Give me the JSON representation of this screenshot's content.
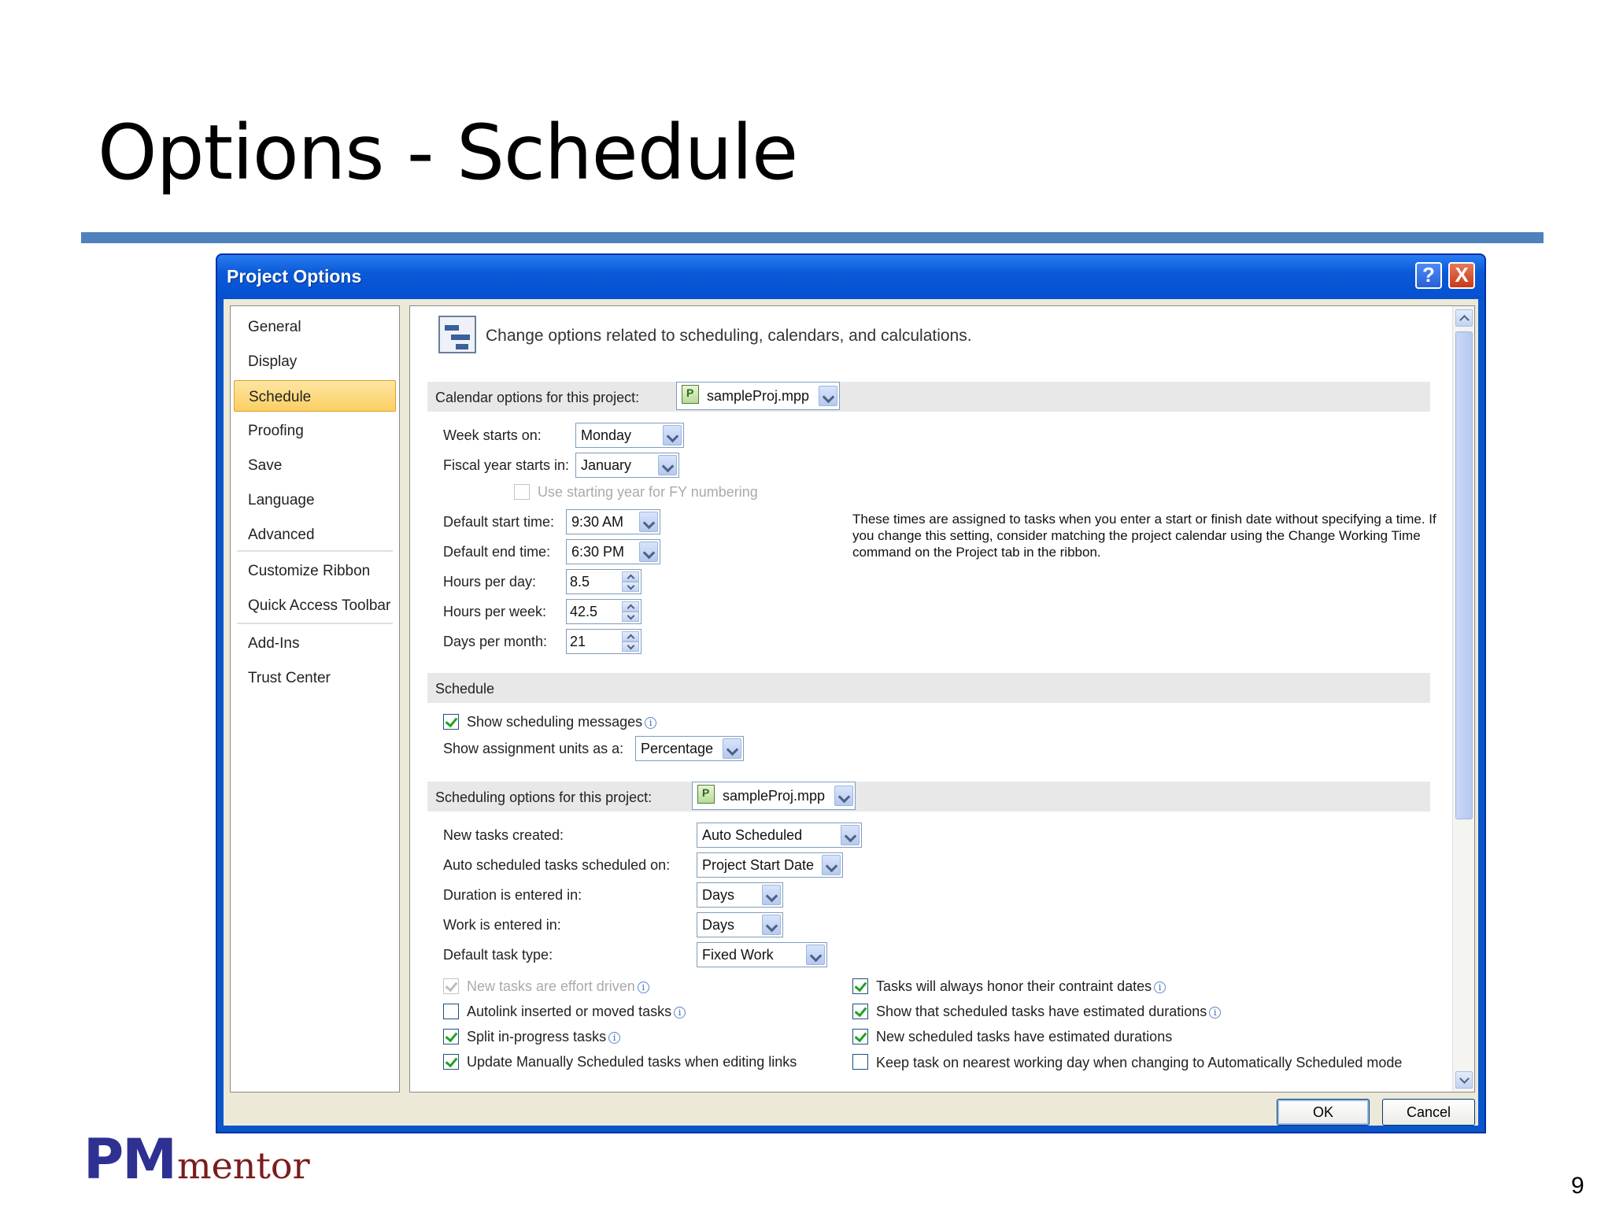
{
  "slide": {
    "title": "Options - Schedule",
    "page_number": "9",
    "logo_pm": "PM",
    "logo_mentor": "mentor"
  },
  "dialog": {
    "title": "Project Options",
    "help_label": "?",
    "close_label": "X",
    "header_text": "Change options related to scheduling, calendars, and calculations.",
    "nav": [
      "General",
      "Display",
      "Schedule",
      "Proofing",
      "Save",
      "Language",
      "Advanced",
      "Customize Ribbon",
      "Quick Access Toolbar",
      "Add-Ins",
      "Trust Center"
    ],
    "ok_label": "OK",
    "cancel_label": "Cancel"
  },
  "calendar": {
    "section_label": "Calendar options for this project:",
    "project_file": "sampleProj.mpp",
    "week_starts_label": "Week starts on:",
    "week_starts_value": "Monday",
    "fiscal_year_label": "Fiscal year starts in:",
    "fiscal_year_value": "January",
    "use_starting_year_label": "Use starting year for FY numbering",
    "default_start_label": "Default start time:",
    "default_start_value": "9:30 AM",
    "default_end_label": "Default end time:",
    "default_end_value": "6:30 PM",
    "hours_per_day_label": "Hours per day:",
    "hours_per_day_value": "8.5",
    "hours_per_week_label": "Hours per week:",
    "hours_per_week_value": "42.5",
    "days_per_month_label": "Days per month:",
    "days_per_month_value": "21",
    "note": "These times are assigned to tasks when you enter a start or finish date without specifying a time. If you change this setting, consider matching the project calendar using the Change Working Time command on the Project tab in the ribbon."
  },
  "schedule": {
    "section_label": "Schedule",
    "show_messages_label": "Show scheduling messages",
    "show_messages_checked": true,
    "assignment_units_label": "Show assignment units as a:",
    "assignment_units_value": "Percentage"
  },
  "scheduling": {
    "section_label": "Scheduling options for this project:",
    "project_file": "sampleProj.mpp",
    "new_tasks_label": "New tasks created:",
    "new_tasks_value": "Auto Scheduled",
    "auto_sched_on_label": "Auto scheduled tasks scheduled on:",
    "auto_sched_on_value": "Project Start Date",
    "duration_label": "Duration is entered in:",
    "duration_value": "Days",
    "work_label": "Work is entered in:",
    "work_value": "Days",
    "task_type_label": "Default task type:",
    "task_type_value": "Fixed Work",
    "left_checks": [
      {
        "label": "New tasks are effort driven",
        "checked": true,
        "disabled": true
      },
      {
        "label": "Autolink inserted or moved tasks",
        "checked": false,
        "disabled": false
      },
      {
        "label": "Split in-progress tasks",
        "checked": true,
        "disabled": false
      },
      {
        "label": "Update Manually Scheduled tasks when editing links",
        "checked": true,
        "disabled": false
      }
    ],
    "right_checks": [
      {
        "label": "Tasks will always honor their contraint dates",
        "checked": true
      },
      {
        "label": "Show that scheduled tasks have estimated durations",
        "checked": true
      },
      {
        "label": "New scheduled tasks have estimated durations",
        "checked": true
      },
      {
        "label": "Keep task on nearest working day when changing to Automatically Scheduled mode",
        "checked": false
      }
    ]
  }
}
